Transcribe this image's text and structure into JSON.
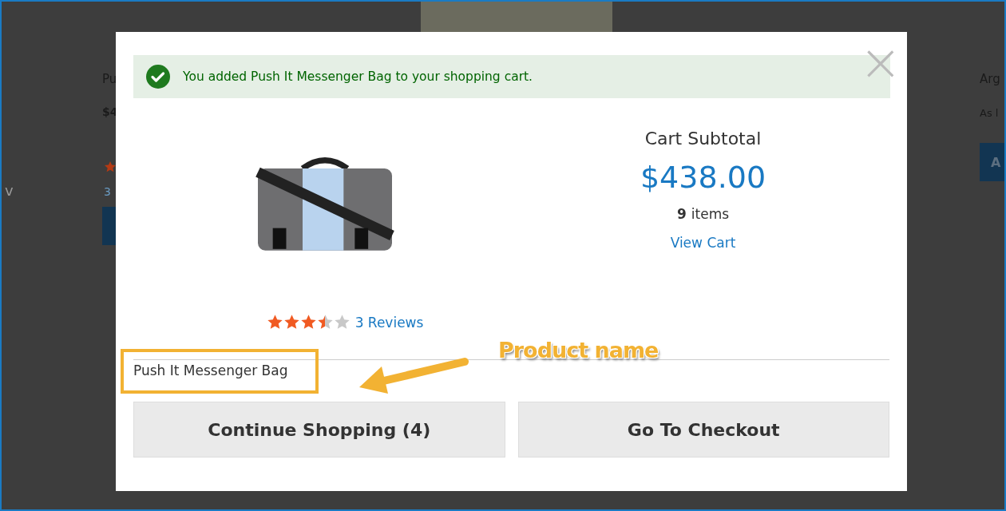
{
  "background_page": {
    "left_edge_text": "v",
    "left_card": {
      "name": "Pu",
      "price": "$4",
      "rating_count": "3"
    },
    "right_card": {
      "name": "Arg",
      "note": "As l",
      "button": "A"
    }
  },
  "modal": {
    "message": "You added Push It Messenger Bag to your shopping cart.",
    "close": "×",
    "product": {
      "stars": 3.5,
      "reviews": "3 Reviews",
      "name": "Push It Messenger Bag"
    },
    "cart": {
      "title": "Cart Subtotal",
      "subtotal": "$438.00",
      "items_count": "9",
      "items_label": "items",
      "view_cart": "View Cart"
    },
    "buttons": [
      "Continue Shopping (4)",
      "Go To Checkout"
    ]
  },
  "annotation": {
    "label": "Product name"
  }
}
